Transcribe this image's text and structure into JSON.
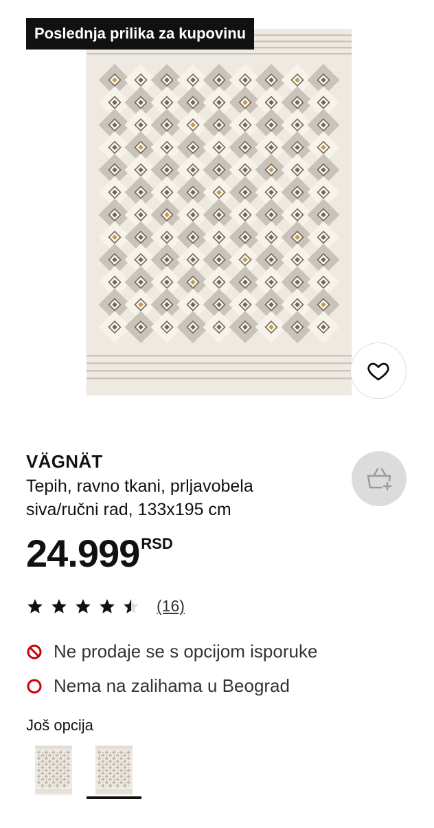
{
  "badge": {
    "label": "Poslednja prilika za kupovinu"
  },
  "product": {
    "name": "VÄGNÄT",
    "description": "Tepih, ravno tkani, prljavobela siva/ručni rad, 133x195 cm",
    "price": "24.999",
    "currency": "RSD"
  },
  "rating": {
    "stars": 4.5,
    "max_stars": 5,
    "review_count": "(16)"
  },
  "availability": [
    {
      "icon": "no-delivery-icon",
      "text": "Ne prodaje se s opcijom isporuke",
      "color": "#cc0008"
    },
    {
      "icon": "out-of-stock-icon",
      "text": "Nema na zalihama u Beograd",
      "color": "#cc0008"
    }
  ],
  "options": {
    "title": "Još opcija",
    "selected_index": 1
  },
  "icons": {
    "favourite": "heart-icon",
    "add_to_cart": "shopping-bag-add-icon"
  },
  "colors": {
    "rug_base": "#eeeae2",
    "rug_grey": "#c9c3ba",
    "rug_dark": "#6f665c",
    "rug_gold": "#c49a4a",
    "cart_button_bg": "#dcdcdc"
  }
}
